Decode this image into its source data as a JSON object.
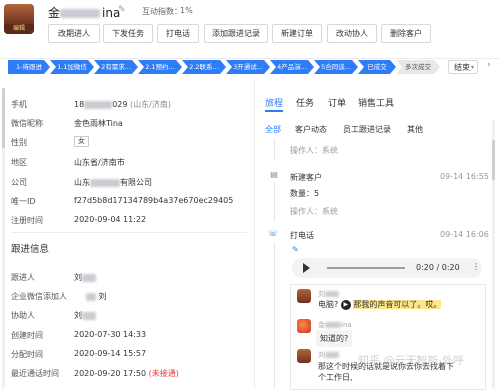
{
  "header": {
    "name_first": "金",
    "name_suffix": "ina",
    "avatar_tag": "编辑",
    "interaction_label": "互动指数：",
    "interaction_value": "1%",
    "buttons": [
      "改期进人",
      "下发任务",
      "打电话",
      "添加跟进记录",
      "新建订单",
      "改动协人",
      "删除客户"
    ]
  },
  "stages": [
    "1-待跟进",
    "1.1加微信",
    "2有需求...",
    "2.1预约...",
    "2.2联系...",
    "3开通试...",
    "4产品演...",
    "5合同谈...",
    "已成交",
    "多次成交"
  ],
  "stage_end": {
    "label": "结束",
    "caret": "▾",
    "arrow": "›"
  },
  "left": {
    "fields": [
      {
        "label": "手机",
        "value_prefix": "18",
        "value_suffix": "029",
        "extra": "(山东/济南)"
      },
      {
        "label": "微信昵称",
        "value": "金色雨林Tina"
      },
      {
        "label": "性别",
        "value": "女"
      },
      {
        "label": "地区",
        "value": "山东省/济南市"
      },
      {
        "label": "公司",
        "value_prefix": "山东",
        "value_suffix": "有限公司"
      },
      {
        "label": "唯一ID",
        "value": "f27d5b8d17134789b4a37e670ec29405"
      },
      {
        "label": "注册时间",
        "value": "2020-09-04 11:22"
      }
    ],
    "follow_title": "跟进信息",
    "follow_fields": [
      {
        "label": "跟进人",
        "value": "刘"
      },
      {
        "label": "企业微信添加人",
        "value": "刘"
      },
      {
        "label": "协助人",
        "value": "刘"
      },
      {
        "label": "创建时间",
        "value": "2020-07-30 14:33"
      },
      {
        "label": "分配时间",
        "value": "2020-09-14 15:57"
      },
      {
        "label": "最近通话时间",
        "value": "2020-09-20 17:50",
        "status": "(未接通)"
      }
    ]
  },
  "right": {
    "tabs": [
      "旅程",
      "任务",
      "订单",
      "销售工具"
    ],
    "subtabs": [
      "全部",
      "客户动态",
      "员工跟进记录",
      "其他"
    ],
    "events": [
      {
        "operator": "操作人：系统"
      },
      {
        "title": "新建客户",
        "time": "09-14 16:55",
        "detail": "数量：5",
        "operator": "操作人：系统"
      },
      {
        "title": "打电话",
        "time": "09-14 16:06"
      }
    ],
    "audio": {
      "time": "0:20 / 0:20",
      "menu": "⋮"
    },
    "chat": [
      {
        "name": "刘",
        "text_pre": "电脑?",
        "text_hl": "那我的声音可以了。哎。"
      },
      {
        "name": "金",
        "name_suffix": "ina",
        "text": "知道的?"
      },
      {
        "name": "刘",
        "text_line1": "那这个时候的话就是说你去你去找着下",
        "text_line2": "个工作日,"
      }
    ]
  },
  "watermark": "知乎 @云天智能·外呼"
}
